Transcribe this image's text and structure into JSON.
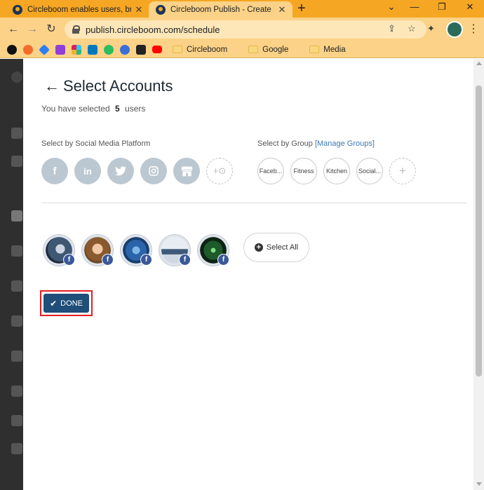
{
  "browser": {
    "tabs": [
      {
        "title": "Circleboom enables users, brand",
        "active": false
      },
      {
        "title": "Circleboom Publish - Create New",
        "active": true
      }
    ],
    "url": "publish.circleboom.com/schedule",
    "bookmarks": [
      "Circleboom",
      "Google",
      "Media"
    ],
    "accent_color": "#f5a623"
  },
  "modal": {
    "title": "Select Accounts",
    "selected_prefix": "You have selected",
    "selected_count": "5",
    "selected_suffix": "users",
    "platform_label": "Select by Social Media Platform",
    "platforms": [
      "facebook-icon",
      "linkedin-icon",
      "twitter-icon",
      "instagram-icon",
      "google-business-icon",
      "add-pinterest-icon"
    ],
    "group_label": "Select by Group",
    "manage_groups_link": "[Manage Groups]",
    "groups": [
      "Faceb...",
      "Fitness",
      "Kitchen",
      "Social..."
    ],
    "accounts_count_shown": 5,
    "select_all_label": "Select All",
    "done_label": "DONE",
    "done_color": "#1f4e79",
    "highlight_color": "#e31e24"
  }
}
